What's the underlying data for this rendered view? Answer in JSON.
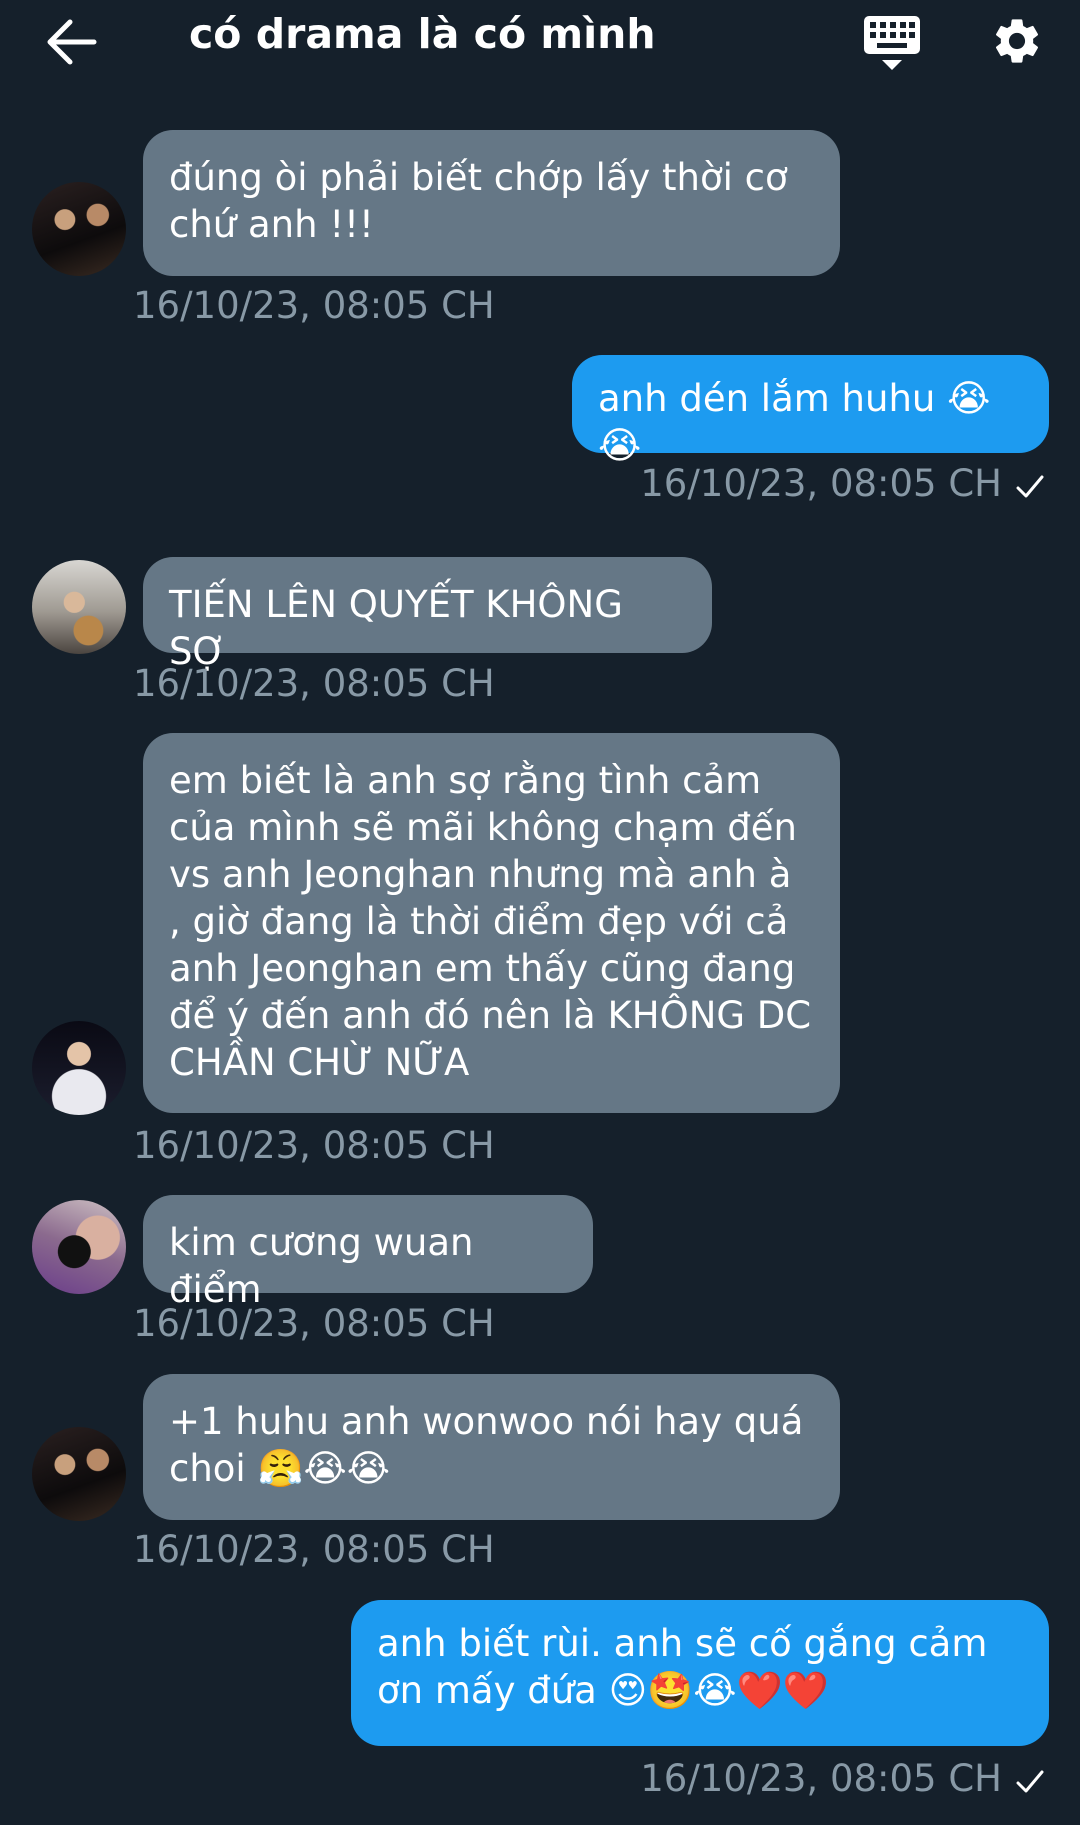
{
  "header": {
    "title": "có drama là có mình"
  },
  "messages": [
    {
      "text": "đúng òi phải biết chớp lấy thời cơ chứ anh !!!",
      "time": "16/10/23, 08:05 CH"
    },
    {
      "text": "anh dén lắm huhu 😭😭",
      "time": "16/10/23, 08:05 CH"
    },
    {
      "text": "TIẾN LÊN QUYẾT KHÔNG SỢ",
      "time": "16/10/23, 08:05 CH"
    },
    {
      "text": "em biết là anh sợ rằng tình cảm của mình sẽ mãi không chạm đến vs anh Jeonghan nhưng mà anh à , giờ đang là thời điểm đẹp với cả anh Jeonghan em thấy cũng đang để ý đến anh đó nên là KHÔNG DC CHẦN CHỪ NỮA",
      "time": "16/10/23, 08:05 CH"
    },
    {
      "text": "kim cương wuan điểm",
      "time": "16/10/23, 08:05 CH"
    },
    {
      "text": "+1 huhu anh wonwoo nói hay quá choi 😤😭😭",
      "time": "16/10/23, 08:05 CH"
    },
    {
      "text": "anh biết rùi.  anh sẽ cố gắng cảm ơn mấy đứa 😍🤩😭❤️❤️",
      "time": "16/10/23, 08:05 CH"
    }
  ],
  "colors": {
    "background": "#15202b",
    "incoming_bubble": "#657786",
    "outgoing_bubble": "#1d9bf0",
    "timestamp": "#8899a6"
  },
  "icons": {
    "back": "arrow-left-icon",
    "keyboard": "keyboard-icon",
    "settings": "gear-icon",
    "sent": "check-icon"
  }
}
